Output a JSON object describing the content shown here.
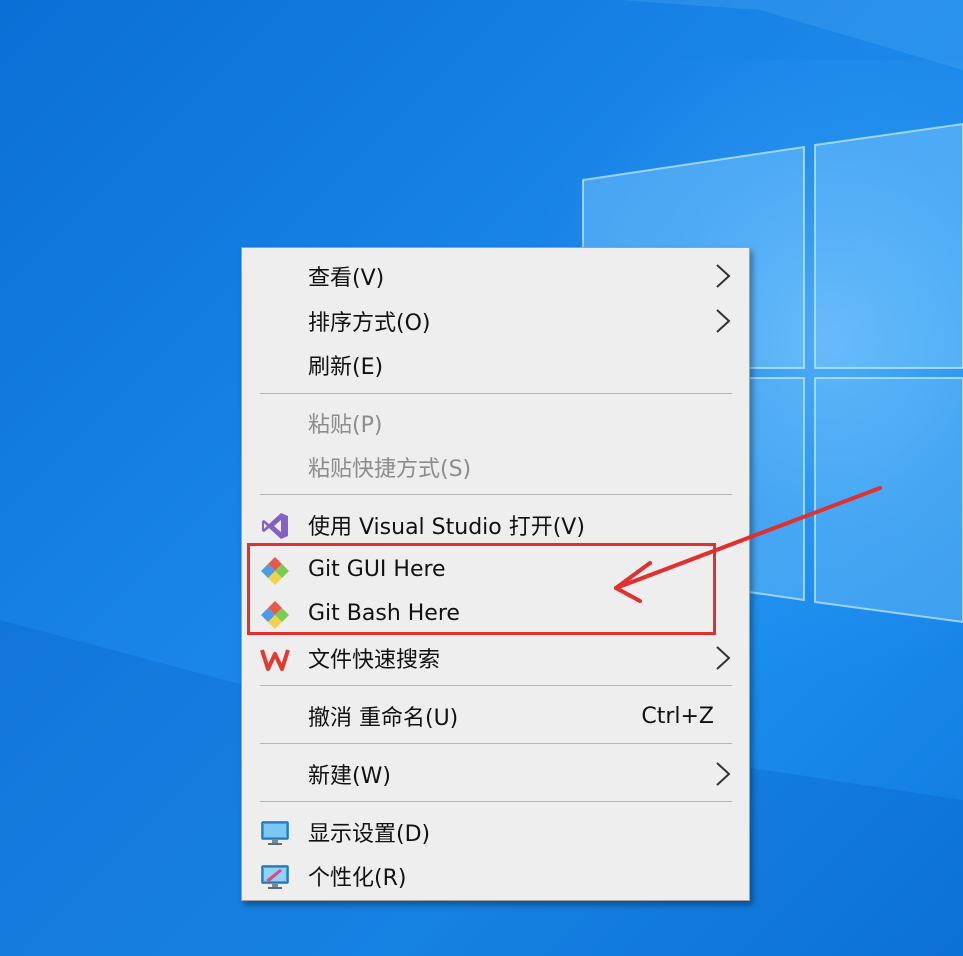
{
  "menu": {
    "items": [
      {
        "label": "查看(V)",
        "submenu": true
      },
      {
        "label": "排序方式(O)",
        "submenu": true
      },
      {
        "label": "刷新(E)"
      },
      {
        "label": "粘贴(P)",
        "disabled": true
      },
      {
        "label": "粘贴快捷方式(S)",
        "disabled": true
      },
      {
        "label": "使用 Visual Studio 打开(V)",
        "icon": "visual-studio-icon"
      },
      {
        "label": "Git GUI Here",
        "icon": "git-icon"
      },
      {
        "label": "Git Bash Here",
        "icon": "git-icon"
      },
      {
        "label": "文件快速搜索",
        "icon": "wps-icon",
        "submenu": true
      },
      {
        "label": "撤消 重命名(U)",
        "shortcut": "Ctrl+Z"
      },
      {
        "label": "新建(W)",
        "submenu": true
      },
      {
        "label": "显示设置(D)",
        "icon": "display-settings-icon"
      },
      {
        "label": "个性化(R)",
        "icon": "personalize-icon"
      }
    ]
  },
  "colors": {
    "annotation": "#e0302f",
    "menu_background": "#eeeeee",
    "disabled_text": "#8c8c8c"
  }
}
